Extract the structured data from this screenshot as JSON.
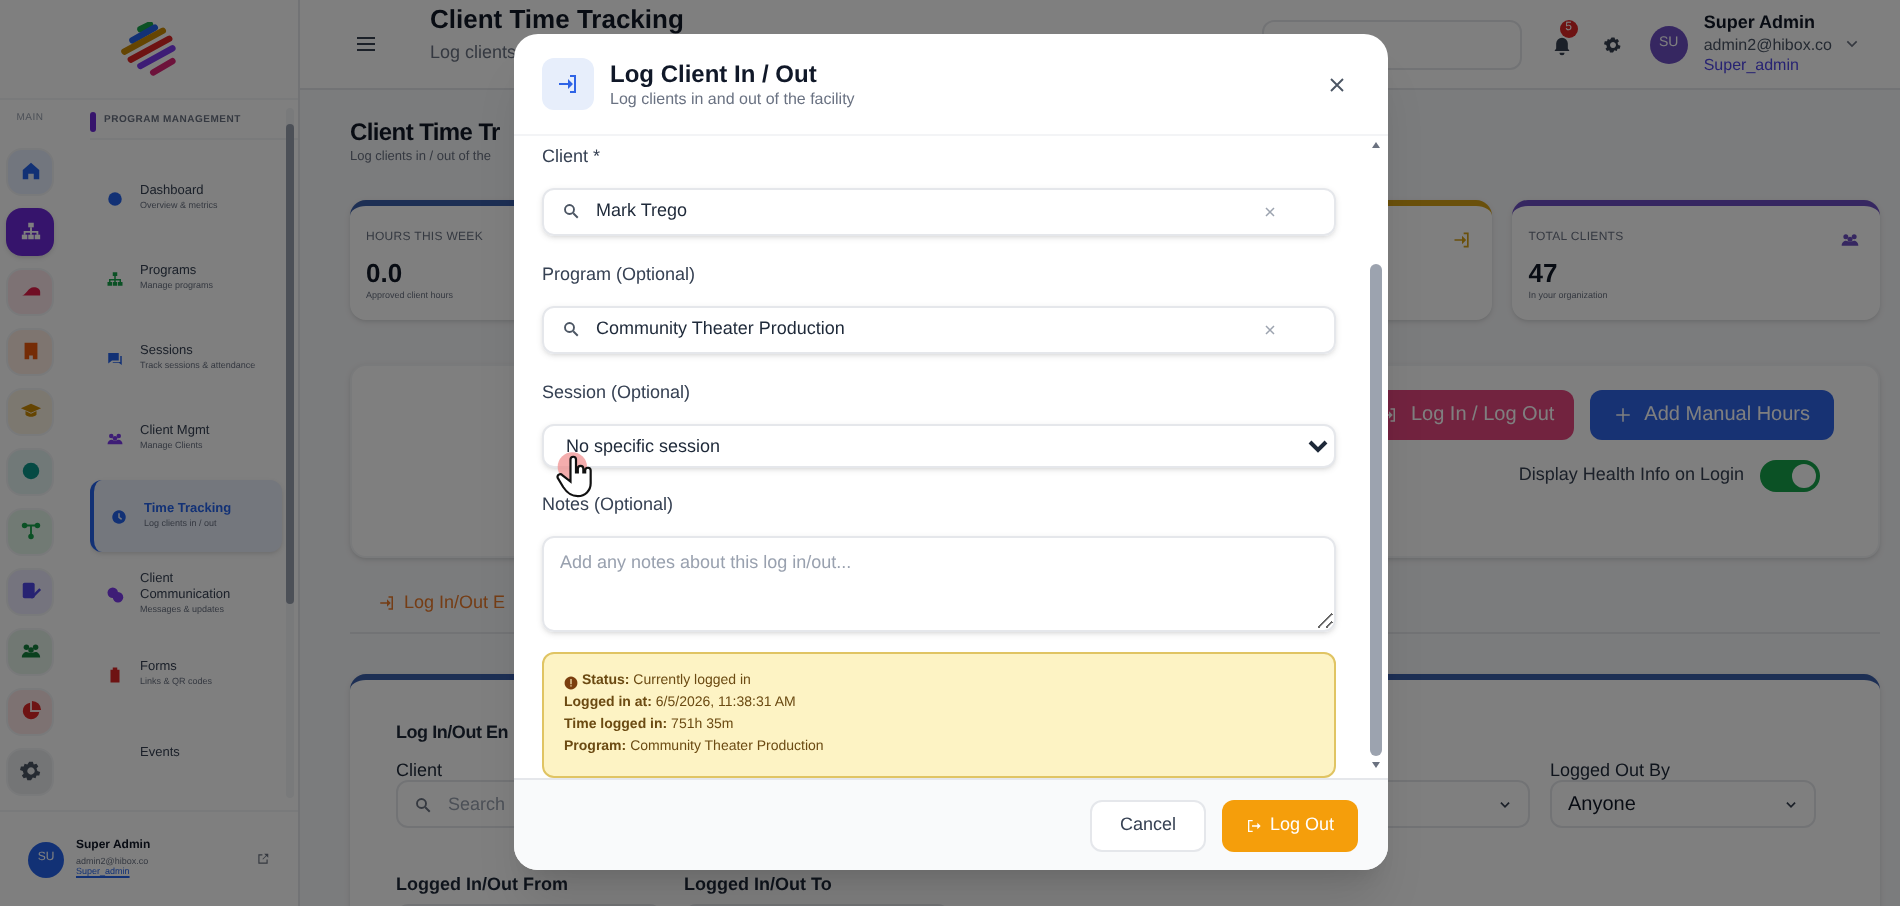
{
  "sidebar": {
    "section_label": "MAIN",
    "rail": [
      {
        "selected": false
      },
      {
        "selected": true
      },
      {
        "selected": false
      },
      {
        "selected": false
      },
      {
        "selected": false
      },
      {
        "selected": false
      },
      {
        "selected": false
      },
      {
        "selected": false
      },
      {
        "selected": false
      },
      {
        "selected": false
      },
      {
        "selected": false
      }
    ],
    "panel_title": "PROGRAM MANAGEMENT",
    "items": [
      {
        "label": "Dashboard",
        "sublabel": "Overview & metrics",
        "selected": false
      },
      {
        "label": "Programs",
        "sublabel": "Manage programs",
        "selected": false
      },
      {
        "label": "Sessions",
        "sublabel": "Track sessions & attendance",
        "selected": false
      },
      {
        "label": "Client Mgmt",
        "sublabel": "Manage Clients",
        "selected": false
      },
      {
        "label": "Time Tracking",
        "sublabel": "Log clients in / out",
        "selected": true
      },
      {
        "label": "Client Communication",
        "sublabel": "Messages & updates",
        "selected": false
      },
      {
        "label": "Forms",
        "sublabel": "Links & QR codes",
        "selected": false
      },
      {
        "label": "Events",
        "selected": false
      }
    ],
    "user": {
      "avatar": "SU",
      "name": "Super Admin",
      "email": "admin2@hibox.co",
      "role": "Super_admin"
    }
  },
  "header": {
    "title": "Client Time Tracking",
    "subtitle": "Log clients",
    "notification_count": "5",
    "user": {
      "avatar": "SU",
      "name": "Super Admin",
      "email": "admin2@hibox.co",
      "role": "Super_admin"
    }
  },
  "page": {
    "title": "Client Time Tr",
    "subtitle": "Log clients in / out of the",
    "stats": [
      {
        "label": "HOURS THIS WEEK",
        "value": "0.0",
        "note": "Approved client hours"
      },
      {
        "kind": "partial"
      },
      {
        "label": "TOTAL CLIENTS",
        "value": "47",
        "note": "In your organization"
      }
    ],
    "actions": [
      {
        "label": "Log In / Log Out",
        "kind": "login"
      },
      {
        "label": "Add Manual Hours",
        "kind": "add"
      }
    ],
    "health_toggle": {
      "label": "Display Health Info on Login",
      "on": true
    },
    "tab": {
      "label": "Log In/Out E",
      "selected": true
    },
    "filters": {
      "heading": "Log In/Out En",
      "row_1": [
        {
          "label": "Client",
          "placeholder": "Search",
          "kind": "search"
        },
        {
          "kind": "select"
        },
        {
          "label": "Logged Out By",
          "value": "Anyone",
          "kind": "select"
        }
      ],
      "row_2": [
        {
          "label": "Logged In/Out From"
        },
        {
          "label": "Logged In/Out To"
        }
      ]
    }
  },
  "modal": {
    "title": "Log Client In / Out",
    "subtitle": "Log clients in and out of the facility",
    "fields": [
      {
        "label": "Client *",
        "value": "Mark Trego",
        "kind": "search"
      },
      {
        "label": "Program (Optional)",
        "value": "Community Theater Production",
        "kind": "search"
      },
      {
        "label": "Session (Optional)",
        "value": "No specific session",
        "kind": "select"
      },
      {
        "label": "Notes (Optional)",
        "placeholder": "Add any notes about this log in/out...",
        "kind": "textarea"
      }
    ],
    "status_lines": [
      "**Status:** Currently logged in",
      "**Logged in at:** 6/5/2026, 11:38:31 AM",
      "**Time logged in:** 751h 35m",
      "**Program:** Community Theater Production"
    ],
    "buttons": [
      {
        "label": "Cancel",
        "kind": "secondary"
      },
      {
        "label": "Log Out",
        "kind": "primary"
      }
    ]
  }
}
